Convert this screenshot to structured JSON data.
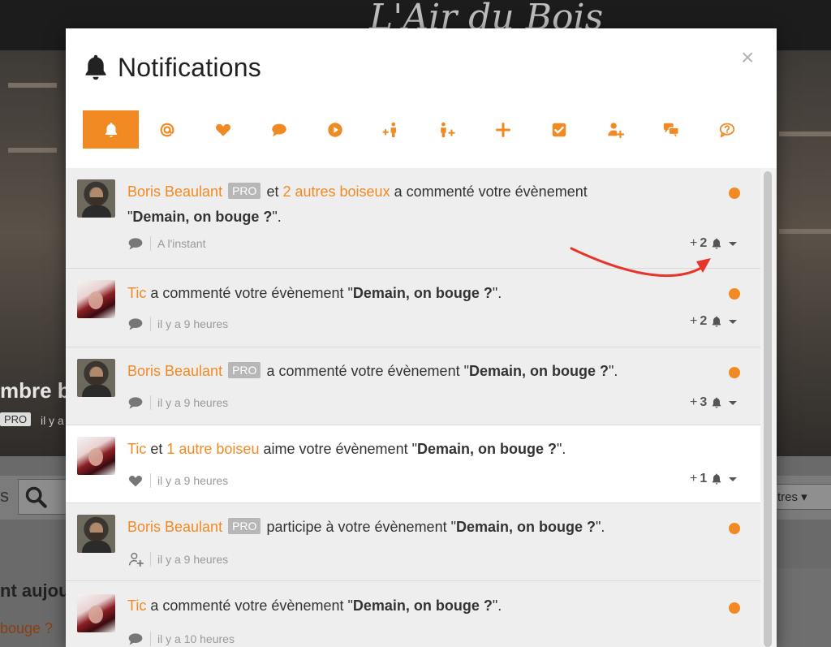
{
  "background": {
    "logo": "L'Air du Bois",
    "hero_title": "mbre b",
    "pro_badge": "PRO",
    "time": "il y a",
    "search_letter": "s",
    "filter_label": "tres",
    "today_label": "nt aujou",
    "event_snippet": "bouge ?"
  },
  "modal": {
    "title": "Notifications",
    "close": "×"
  },
  "tabs": [
    {
      "name": "all",
      "icon": "bell-icon",
      "active": true
    },
    {
      "name": "mentions",
      "icon": "at-icon"
    },
    {
      "name": "likes",
      "icon": "heart-icon"
    },
    {
      "name": "comments",
      "icon": "speech-bubble-icon"
    },
    {
      "name": "plays",
      "icon": "play-icon"
    },
    {
      "name": "followers",
      "icon": "follow-plus-icon"
    },
    {
      "name": "follows",
      "icon": "person-plus-icon"
    },
    {
      "name": "additions",
      "icon": "plus-icon"
    },
    {
      "name": "tasks",
      "icon": "checkbox-icon"
    },
    {
      "name": "participations",
      "icon": "user-plus-icon"
    },
    {
      "name": "messages",
      "icon": "chat-bubbles-icon"
    },
    {
      "name": "questions",
      "icon": "question-bubble-icon"
    }
  ],
  "notifications": [
    {
      "actor": "Boris Beaulant",
      "pro": "PRO",
      "conj": "et",
      "others": "2 autres boiseux",
      "action": "a commenté votre évènement",
      "quote_open": "\"",
      "event": "Demain, on bouge ?",
      "quote_close": "\".",
      "time": "A l'instant",
      "count_plus": "+",
      "count": "2",
      "type_icon": "comment-icon",
      "unread": true
    },
    {
      "actor": "Tic",
      "action": "a commenté votre évènement \"",
      "event": "Demain, on bouge ?",
      "quote_close": "\".",
      "time": "il y a 9 heures",
      "count_plus": "+",
      "count": "2",
      "type_icon": "comment-icon",
      "unread": true
    },
    {
      "actor": "Boris Beaulant",
      "pro": "PRO",
      "action": "a commenté votre évènement \"",
      "event": "Demain, on bouge ?",
      "quote_close": "\".",
      "time": "il y a 9 heures",
      "count_plus": "+",
      "count": "3",
      "type_icon": "comment-icon",
      "unread": true
    },
    {
      "actor": "Tic",
      "conj": "et",
      "others": "1 autre boiseu",
      "action": "aime votre évènement \"",
      "event": "Demain, on bouge ?",
      "quote_close": "\".",
      "time": "il y a 9 heures",
      "count_plus": "+",
      "count": "1",
      "type_icon": "heart-icon",
      "unread": false
    },
    {
      "actor": "Boris Beaulant",
      "pro": "PRO",
      "action": "participe à votre évènement \"",
      "event": "Demain, on bouge ?",
      "quote_close": "\".",
      "time": "il y a 9 heures",
      "type_icon": "user-plus-icon",
      "unread": true
    },
    {
      "actor": "Tic",
      "action": "a commenté votre évènement \"",
      "event": "Demain, on bouge ?",
      "quote_close": "\".",
      "time": "il y a 10 heures",
      "type_icon": "comment-icon",
      "unread": true
    }
  ],
  "colors": {
    "accent": "#f28a24",
    "annotation_arrow": "#e8352b"
  }
}
